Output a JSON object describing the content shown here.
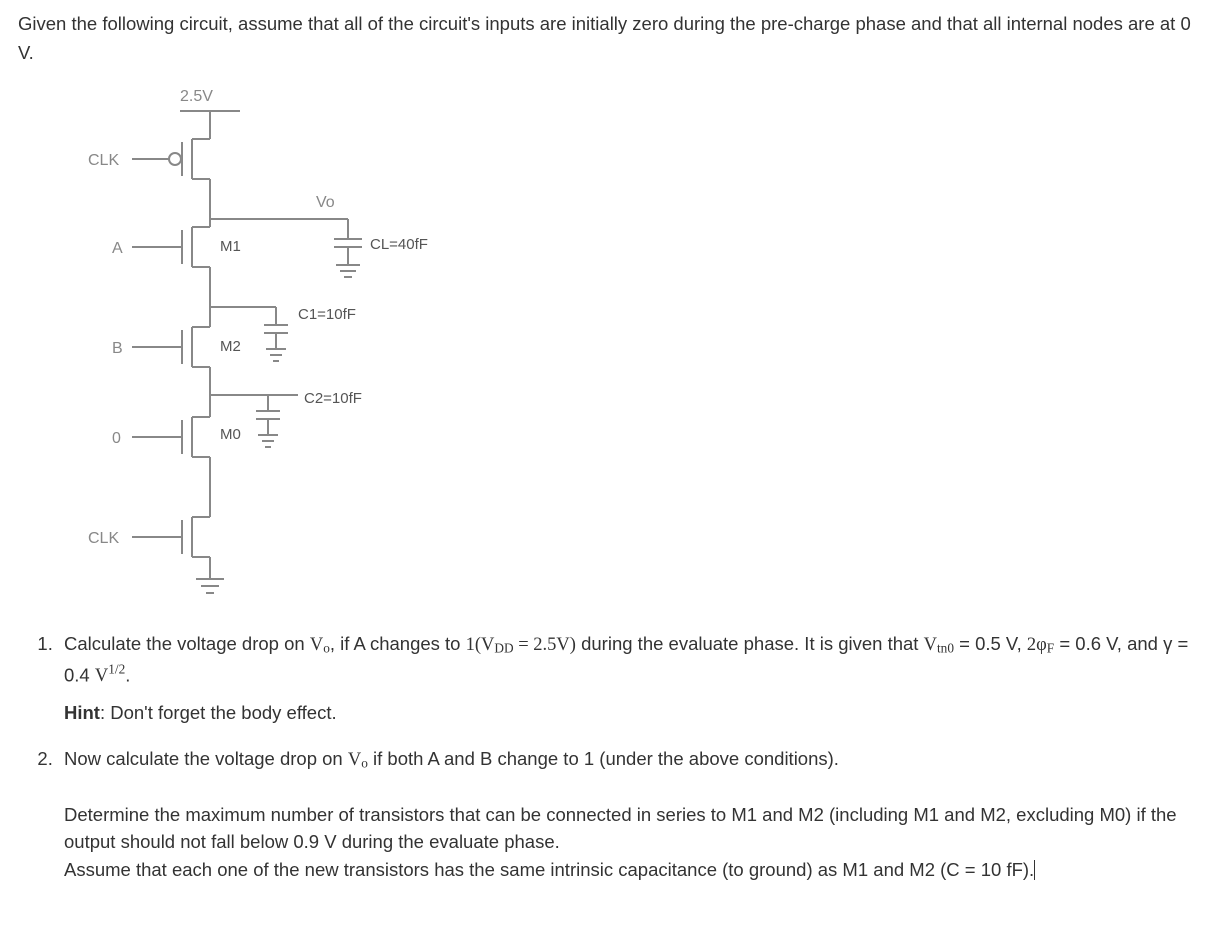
{
  "intro": "Given the following circuit, assume that all of the circuit's inputs are initially zero during the pre-charge phase and that all internal nodes are at 0 V.",
  "diagram": {
    "vdd": "2.5V",
    "clk_top": "CLK",
    "clk_bot": "CLK",
    "in_a": "A",
    "in_b": "B",
    "in_0": "0",
    "m1": "M1",
    "m2": "M2",
    "m0": "M0",
    "vo": "Vo",
    "cl": "CL=40fF",
    "c1": "C1=10fF",
    "c2": "C2=10fF"
  },
  "q1": {
    "a": "Calculate the voltage drop on ",
    "vo": "V",
    "vo_sub": "o",
    "b": ", if A changes to ",
    "one_vdd": "1(V",
    "dd_sub": "DD",
    "eq25": " = 2.5V)",
    "c": " during the evaluate phase. It is given that ",
    "vtn": "V",
    "tn_sub": "tn0",
    "d": " = 0.5 V, ",
    "twophi": "2φ",
    "f_sub": "F",
    "e": " = 0.6 V, and γ = 0.4 ",
    "vhalf": "V",
    "half_sup": "1/2",
    "f": ".",
    "hint_label": "Hint",
    "hint_text": ": Don't forget the body effect."
  },
  "q2": {
    "a": "Now calculate the voltage drop on ",
    "vo": "V",
    "vo_sub": "o",
    "b": " if both A and B change to 1 (under the above conditions).",
    "p1": "Determine the maximum number of transistors that can be connected in series to M1 and M2 (including M1 and M2, excluding M0) if the output should not fall below 0.9 V during the evaluate phase.",
    "p2": "Assume that each one of the new transistors has the same intrinsic capacitance (to ground) as M1 and M2 (C = 10 fF)."
  }
}
